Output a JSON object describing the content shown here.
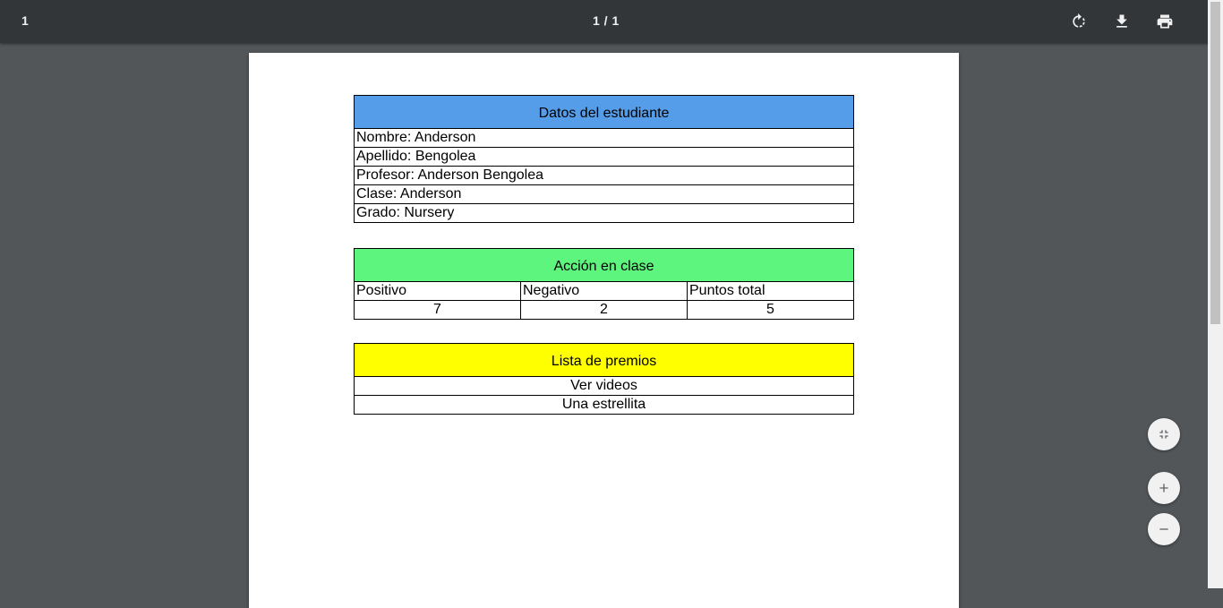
{
  "toolbar": {
    "title": "1",
    "page_indicator": "1 / 1",
    "rotate_icon": "rotate-icon",
    "download_icon": "download-icon",
    "print_icon": "print-icon"
  },
  "student_table": {
    "header": "Datos del estudiante",
    "rows": [
      "Nombre: Anderson",
      "Apellido: Bengolea",
      "Profesor: Anderson Bengolea",
      "Clase: Anderson",
      "Grado: Nursery"
    ],
    "header_color": "#559de9"
  },
  "action_table": {
    "header": "Acción en clase",
    "columns": [
      "Positivo",
      "Negativo",
      "Puntos total"
    ],
    "values": [
      "7",
      "2",
      "5"
    ],
    "header_color": "#5ef57e"
  },
  "prizes_table": {
    "header": "Lista de premios",
    "items": [
      "Ver videos",
      "Una estrellita"
    ],
    "header_color": "#ffff00"
  },
  "controls": {
    "fit_icon": "fit-to-page-icon",
    "zoom_in_icon": "zoom-in-icon",
    "zoom_out_icon": "zoom-out-icon"
  }
}
